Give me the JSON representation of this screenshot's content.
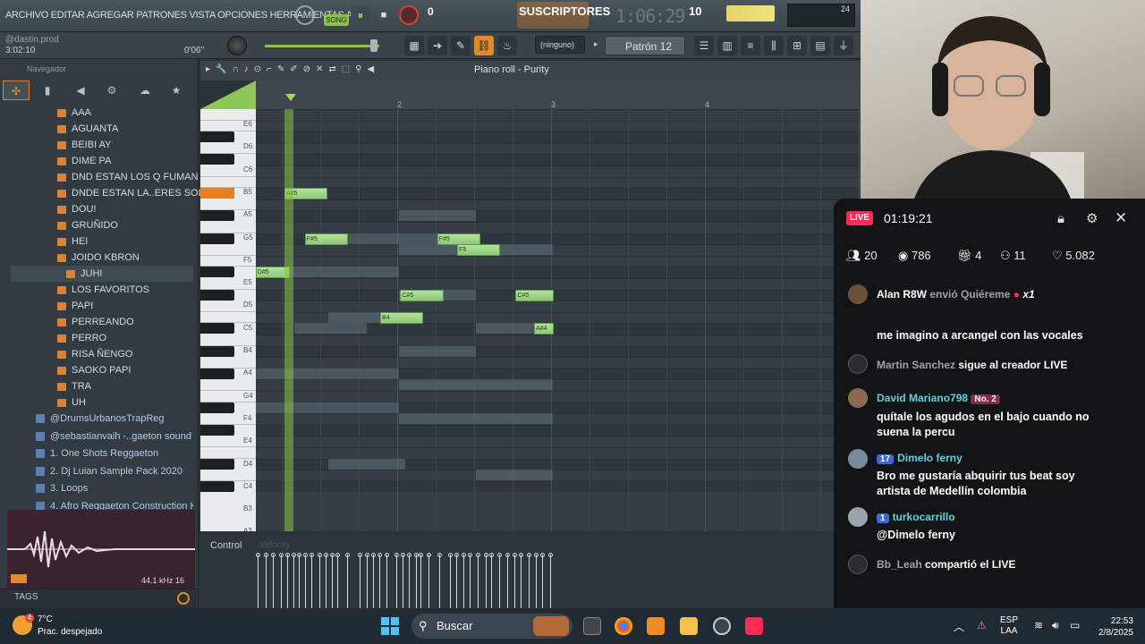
{
  "menu": {
    "text": "ARCHIVO EDITAR AGREGAR PATRONES VISTA OPCIONES HERRAMIENTAS AYU"
  },
  "transport": {
    "song_label": "SONG",
    "pause_icon": "⏸",
    "stop_icon": "■",
    "tempo": "0",
    "subs_label": "SUSCRIPTORES",
    "time": "1:06:29",
    "subs_count": "10",
    "cpu_value": "24"
  },
  "hint": {
    "user": "@dastin.prod",
    "time_left": "3:02:10",
    "time_right": "0'06''"
  },
  "toolbar": {
    "pattern_select": "(ninguno)",
    "pattern_name": "Patrón 12"
  },
  "browser": {
    "title": "Navegador",
    "folders": [
      "AAA",
      "AGUANTA",
      "BEIBI AY",
      "DIME PA",
      "DND ESTAN LOS Q FUMAN MARI",
      "DNDE ESTAN LA..ERES SOLTERAS",
      "DOU!",
      "GRUÑIDO",
      "HEI",
      "JOIDO KBRON",
      "JUHI",
      "LOS FAVORITOS",
      "PAPI",
      "PERREANDO",
      "PERRO",
      "RISA ÑENGO",
      "SAOKO PAPI",
      "TRA",
      "UH"
    ],
    "selected": "JUHI",
    "sources": [
      "@DrumsUrbanosTrapReg",
      "@sebastianvaih -..gaeton sound kit)",
      "1. One Shots Reggaeton",
      "2. Dj Luian Sample Pack 2020",
      "3. Loops",
      "4. Afro Reggaeton Construction Kits"
    ],
    "wave_info": "44.1 kHz 16",
    "tags_label": "TAGS"
  },
  "piano_roll": {
    "title": "Piano roll - Purity",
    "bars": [
      "2",
      "3",
      "4"
    ],
    "key_labels": [
      "E6",
      "D6",
      "C6",
      "B5",
      "A5",
      "G5",
      "F5",
      "E5",
      "D5",
      "C5",
      "B4",
      "A4",
      "G4",
      "F4",
      "E4",
      "D4",
      "C4",
      "B3",
      "A3"
    ],
    "notes": [
      {
        "label": "A#5",
        "start": 0.1875,
        "len": 0.28,
        "pitch": 82
      },
      {
        "label": "F#5",
        "start": 0.32,
        "len": 0.28,
        "pitch": 78
      },
      {
        "label": "D#5",
        "start": 0.0,
        "len": 0.22,
        "pitch": 75
      },
      {
        "label": "F#5",
        "start": 1.18,
        "len": 0.28,
        "pitch": 78
      },
      {
        "label": "F5",
        "start": 1.31,
        "len": 0.28,
        "pitch": 77
      },
      {
        "label": "C#5",
        "start": 0.94,
        "len": 0.28,
        "pitch": 73
      },
      {
        "label": "C#5",
        "start": 1.69,
        "len": 0.25,
        "pitch": 73
      },
      {
        "label": "B4",
        "start": 0.81,
        "len": 0.28,
        "pitch": 71
      },
      {
        "label": "A#4",
        "start": 1.81,
        "len": 0.13,
        "pitch": 70
      }
    ],
    "control_label": "Control",
    "control_sub": "Velocity"
  },
  "stream": {
    "live_label": "LIVE",
    "live_time": "01:19:21",
    "stats": {
      "viewers": "20",
      "views": "786",
      "gifts": "4",
      "follows": "11",
      "likes": "5.082"
    },
    "messages": [
      {
        "user": "Alan R8W",
        "text": "envió Quiéreme",
        "extra": "x1"
      },
      {
        "user": "",
        "text": "me imagino a arcangel con las vocales"
      },
      {
        "user": "Martin Sanchez",
        "text": "sigue al creador LIVE"
      },
      {
        "user": "David Mariano798",
        "badge": "No. 2",
        "text": "quítale los agudos en el bajo cuando no suena la percu"
      },
      {
        "user": "Dimelo ferny",
        "badge": "17",
        "text": "Bro me gustaría abquirir tus beat soy artista de Medellín colombia"
      },
      {
        "user": "turkocarrillo",
        "badge": "1",
        "text": "@Dimelo ferny"
      },
      {
        "user": "Bb_Leah",
        "text": "compartió el LIVE"
      }
    ]
  },
  "taskbar": {
    "temp": "7°C",
    "weather": "Prac. despejado",
    "weather_badge": "4",
    "search": "Buscar",
    "lang_top": "ESP",
    "lang_bottom": "LAA",
    "time": "22:53",
    "date": "2/8/2025"
  }
}
